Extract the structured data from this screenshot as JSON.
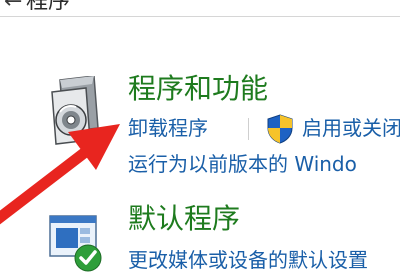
{
  "header": {
    "back_glyph": "←",
    "title": "程序"
  },
  "programs": {
    "title": "程序和功能",
    "uninstall_link": "卸载程序",
    "features_link": "启用或关闭",
    "compat_link": "运行为以前版本的 Windo"
  },
  "defaults": {
    "title": "默认程序",
    "desc_link": "更改媒体或设备的默认设置"
  },
  "colors": {
    "title_green": "#1e7b1e",
    "link_blue": "#1a5fa8",
    "arrow_red": "#e8251f"
  },
  "icons": {
    "programs": "program-disk-icon",
    "shield": "uac-shield-icon",
    "defaults": "default-programs-icon",
    "arrow": "red-arrow-annotation"
  }
}
